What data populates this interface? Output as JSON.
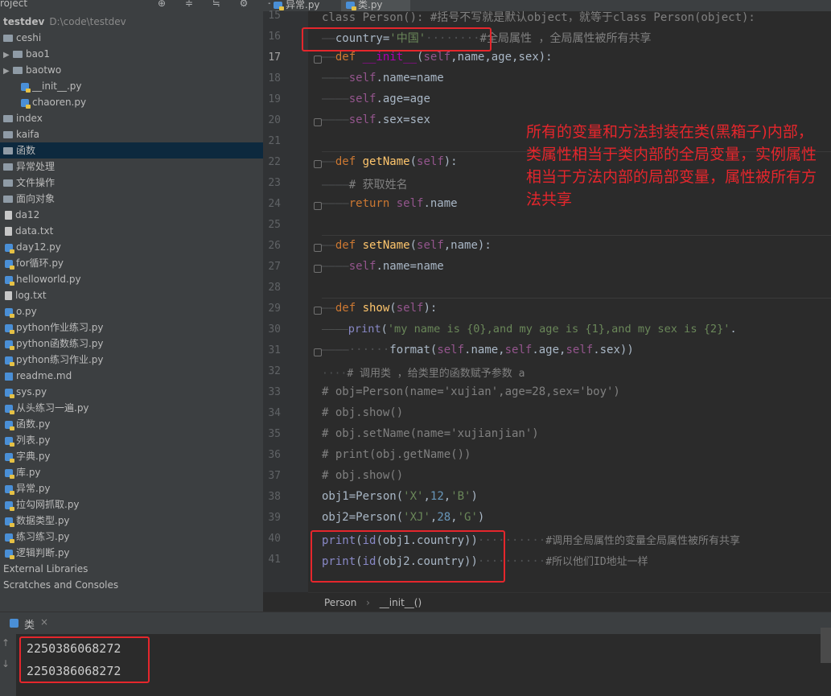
{
  "topbar": {
    "project_label": "roject",
    "tools": "⊕ ≑ ≒ ⚙ −"
  },
  "tabs": [
    {
      "label": "异常.py"
    },
    {
      "label": "类.py"
    }
  ],
  "tree": {
    "root": {
      "name": "testdev",
      "path": "D:\\code\\testdev"
    },
    "items": [
      "ceshi",
      "bao1",
      "baotwo",
      "__init__.py",
      "chaoren.py",
      "index",
      "kaifa",
      "函数",
      "异常处理",
      "文件操作",
      "面向对象",
      "da12",
      "data.txt",
      "day12.py",
      "for循环.py",
      "helloworld.py",
      "log.txt",
      "o.py",
      "python作业练习.py",
      "python函数练习.py",
      "python练习作业.py",
      "readme.md",
      "sys.py",
      "从头练习一遍.py",
      "函数.py",
      "列表.py",
      "字典.py",
      "库.py",
      "异常.py",
      "拉勾网抓取.py",
      "数据类型.py",
      "练习练习.py",
      "逻辑判断.py",
      "External Libraries",
      "Scratches and Consoles"
    ]
  },
  "editor": {
    "line_numbers": [
      "15",
      "16",
      "17",
      "18",
      "19",
      "20",
      "21",
      "22",
      "23",
      "24",
      "25",
      "26",
      "27",
      "28",
      "29",
      "30",
      "31",
      "32",
      "33",
      "34",
      "35",
      "36",
      "37",
      "38",
      "39",
      "40",
      "41"
    ],
    "code": {
      "l15": "class Person(): #括号不写就是默认object，就等于class Person(object):",
      "l16_a": "country=",
      "l16_s": "'中国'",
      "l16_c": "#全局属性 ，全局属性被所有共享",
      "l17_kw": "def ",
      "l17_fn": "__init__",
      "l17_p1": "(",
      "l17_self": "self",
      "l17_p2": ",name,age,sex):",
      "l18_self": "self",
      "l18_r": ".name=name",
      "l19_self": "self",
      "l19_r": ".age=age",
      "l20_self": "self",
      "l20_r": ".sex=sex",
      "l22_kw": "def ",
      "l22_fn": "getName",
      "l22_p1": "(",
      "l22_self": "self",
      "l22_p2": "):",
      "l23_c": "# 获取姓名",
      "l24_kw": "return ",
      "l24_self": "self",
      "l24_r": ".name",
      "l26_kw": "def ",
      "l26_fn": "setName",
      "l26_p1": "(",
      "l26_self": "self",
      "l26_p2": ",name):",
      "l27_self": "self",
      "l27_r": ".name=name",
      "l29_kw": "def ",
      "l29_fn": "show",
      "l29_p1": "(",
      "l29_self": "self",
      "l29_p2": "):",
      "l30_bi": "print",
      "l30_p": "(",
      "l30_s": "'my name is {0},and my age is {1},and my sex is {2}'",
      "l30_e": ".",
      "l31_a": "format(",
      "l31_s1": "self",
      "l31_b": ".name,",
      "l31_s2": "self",
      "l31_c": ".age,",
      "l31_s3": "self",
      "l31_d": ".sex))",
      "l32_c": "# 调用类 ，给类里的函数赋予参数 a",
      "l33": "# obj=Person(name='xujian',age=28,sex='boy')",
      "l34": "# obj.show()",
      "l35": "# obj.setName(name='xujianjian')",
      "l36": "# print(obj.getName())",
      "l37": "# obj.show()",
      "l38_a": "obj1=Person(",
      "l38_s1": "'X'",
      "l38_b": ",",
      "l38_n": "12",
      "l38_c": ",",
      "l38_s2": "'B'",
      "l38_d": ")",
      "l39_a": "obj2=Person(",
      "l39_s1": "'XJ'",
      "l39_b": ",",
      "l39_n": "28",
      "l39_c": ",",
      "l39_s2": "'G'",
      "l39_d": ")",
      "l40_bi": "print",
      "l40_a": "(",
      "l40_bi2": "id",
      "l40_b": "(obj1.country))",
      "l40_c": "#调用全局属性的变量全局属性被所有共享",
      "l41_bi": "print",
      "l41_a": "(",
      "l41_bi2": "id",
      "l41_b": "(obj2.country))",
      "l41_c": "#所以他们ID地址一样"
    },
    "annotation": "所有的变量和方法封装在类(黑箱子)内部，类属性相当于类内部的全局变量，实例属性相当于方法内部的局部变量，属性被所有方法共享",
    "breadcrumb": {
      "class": "Person",
      "sep": "›",
      "method": "__init__()"
    }
  },
  "run": {
    "tab_label": "类",
    "close": "×",
    "output": [
      "2250386068272",
      "2250386068272"
    ]
  },
  "colors": {
    "highlight": "#e5262c",
    "keyword": "#cc7832",
    "string": "#6a8759",
    "self": "#94558d"
  }
}
